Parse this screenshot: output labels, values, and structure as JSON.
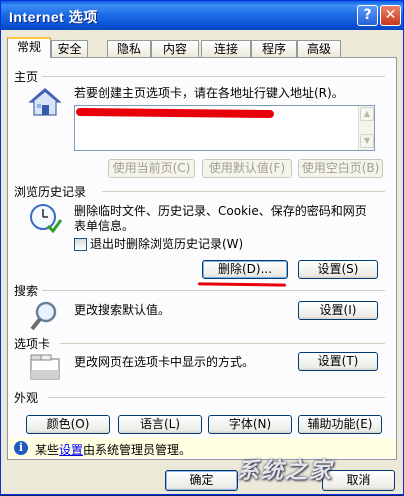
{
  "window": {
    "title": "Internet 选项",
    "help_glyph": "?",
    "close_glyph": "✕"
  },
  "tabs": [
    {
      "label": "常规",
      "active": true
    },
    {
      "label": "安全"
    },
    {
      "label": "隐私"
    },
    {
      "label": "内容"
    },
    {
      "label": "连接"
    },
    {
      "label": "程序"
    },
    {
      "label": "高级"
    }
  ],
  "home": {
    "title": "主页",
    "description": "若要创建主页选项卡，请在各地址行键入地址(R)。",
    "url_value": "",
    "buttons": {
      "current": "使用当前页(C)",
      "default": "使用默认值(F)",
      "blank": "使用空白页(B)"
    }
  },
  "history": {
    "title": "浏览历史记录",
    "description_line1": "删除临时文件、历史记录、Cookie、保存的密码和网页",
    "description_line2": "表单信息。",
    "checkbox_label": "退出时删除浏览历史记录(W)",
    "checkbox_checked": false,
    "delete_label": "删除(D)...",
    "settings_label": "设置(S)"
  },
  "search": {
    "title": "搜索",
    "description": "更改搜索默认值。",
    "settings_label": "设置(I)"
  },
  "tabsection": {
    "title": "选项卡",
    "description": "更改网页在选项卡中显示的方式。",
    "settings_label": "设置(T)"
  },
  "appearance": {
    "title": "外观",
    "colors": "颜色(O)",
    "languages": "语言(L)",
    "fonts": "字体(N)",
    "accessibility": "辅助功能(E)"
  },
  "infobar": {
    "text_before": "某些",
    "link": "设置",
    "text_after": "由系统管理员管理。"
  },
  "footer": {
    "ok": "确定",
    "cancel": "取消"
  },
  "watermark": "系统之家",
  "colors": {
    "accent_red": "#e8000b",
    "title_blue": "#0a5fe4"
  }
}
